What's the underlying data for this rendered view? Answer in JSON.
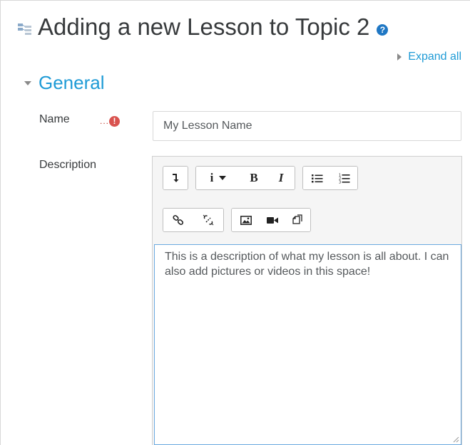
{
  "header": {
    "title": "Adding a new Lesson to Topic 2",
    "help_icon": "?"
  },
  "expand_all": "Expand all",
  "section": {
    "title": "General"
  },
  "fields": {
    "name": {
      "label": "Name",
      "required_icon": "!",
      "required_dots": "...",
      "value": "My Lesson Name"
    },
    "description": {
      "label": "Description",
      "content": "This is a description of what my lesson is all about. I can also add pictures or videos in this space!"
    }
  },
  "toolbar": {
    "info_label": "i",
    "bold_label": "B",
    "italic_label": "I"
  },
  "colors": {
    "accent": "#1f9bd6",
    "required": "#d9534f",
    "help": "#1f77c4"
  }
}
